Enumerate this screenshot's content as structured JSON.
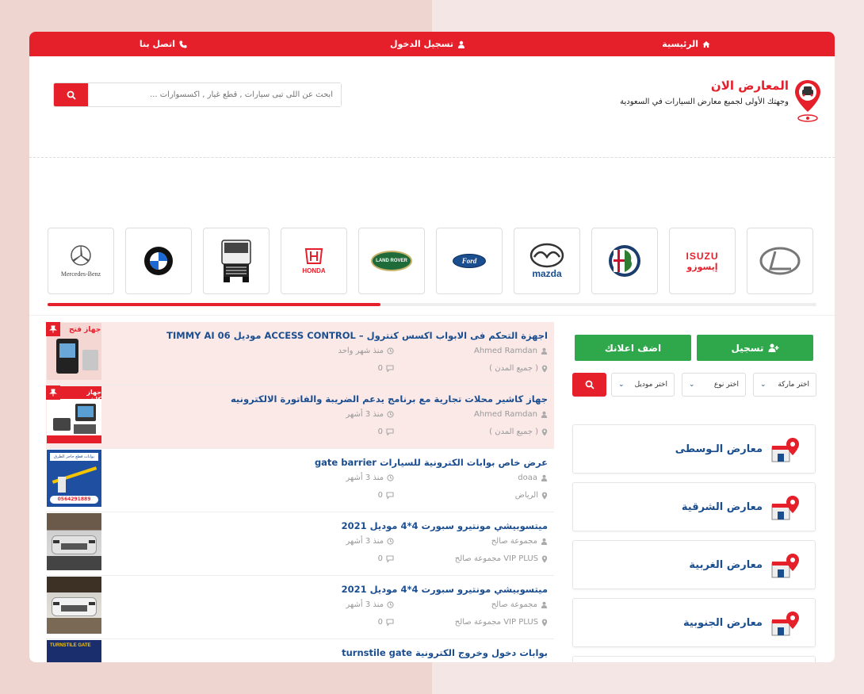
{
  "topnav": {
    "home": "الرئيسية",
    "login": "تسجيل الدخول",
    "contact": "اتصل بنا"
  },
  "header": {
    "site_title": "المعارض الان",
    "tagline": "وجهتك الأولى لجميع معارض السيارات في السعودية",
    "search_placeholder": "ابحث عن اللى تبى سيارات , قطع غيار , اكسسوارات ..."
  },
  "brands": [
    {
      "name": "lexus",
      "text": ""
    },
    {
      "name": "isuzu",
      "text": "ISUZU",
      "text2": "إيسوزو"
    },
    {
      "name": "alfa-romeo",
      "text": ""
    },
    {
      "name": "mazda",
      "text": "mazda"
    },
    {
      "name": "ford",
      "text": "Ford"
    },
    {
      "name": "land-rover",
      "text": "LAND ROVER"
    },
    {
      "name": "honda",
      "text": "HONDA"
    },
    {
      "name": "man-truck",
      "text": ""
    },
    {
      "name": "bmw",
      "text": "BMW"
    },
    {
      "name": "mercedes-benz",
      "text": "Mercedes-Benz"
    }
  ],
  "listings": [
    {
      "title": "اجهزة التحكم فى الابواب اكسس كنترول – ACCESS CONTROL موديل TIMMY AI 06",
      "author": "Ahmed Ramdan",
      "time": "منذ شهر واحد",
      "location": "( جميع المدن )",
      "comments": "0",
      "featured": true
    },
    {
      "title": "جهاز كاشير محلات تجارية مع برنامج يدعم الضريبة والفاتورة الالكترونيه",
      "author": "Ahmed Ramdan",
      "time": "منذ 3 أشهر",
      "location": "( جميع المدن )",
      "comments": "0",
      "featured": true
    },
    {
      "title": "عرض خاص بوابات الكترونية للسيارات gate barrier",
      "author": "doaa",
      "time": "منذ 3 أشهر",
      "location": "الرياض",
      "comments": "0",
      "featured": false
    },
    {
      "title": "ميتسوبيشي مونتيرو سبورت 4*4 موديل 2021",
      "author": "مجموعة صالح",
      "time": "منذ 3 أشهر",
      "location": "VIP PLUS مجموعة صالح",
      "comments": "0",
      "featured": false
    },
    {
      "title": "ميتسوبيشي مونتيرو سبورت 4*4 موديل 2021",
      "author": "مجموعة صالح",
      "time": "منذ 3 أشهر",
      "location": "VIP PLUS مجموعة صالح",
      "comments": "0",
      "featured": false
    },
    {
      "title": "بوابات دخول وخروج الكترونية turnstile gate",
      "author": "",
      "time": "",
      "location": "",
      "comments": "",
      "featured": false
    }
  ],
  "thumb_text": {
    "t0": "جهاز فتح",
    "t1": "جهاز كاشير",
    "t2": "بوابات قطع حاجز الطرق",
    "t2b": "0564291889",
    "t5": "TURNSTILE GATE"
  },
  "sidebar": {
    "register_label": "تسجيل",
    "add_ad_label": "اضف اعلانك",
    "brand_select": "اختر ماركة",
    "type_select": "اختر نوع",
    "model_select": "اختر موديل",
    "regions": [
      "معارض الـوسطى",
      "معارض الشرقية",
      "معارض الغربية",
      "معارض الجنوبية"
    ]
  },
  "colors": {
    "accent": "#e5202b",
    "green": "#2ea84a",
    "link": "#1b4e8f"
  }
}
